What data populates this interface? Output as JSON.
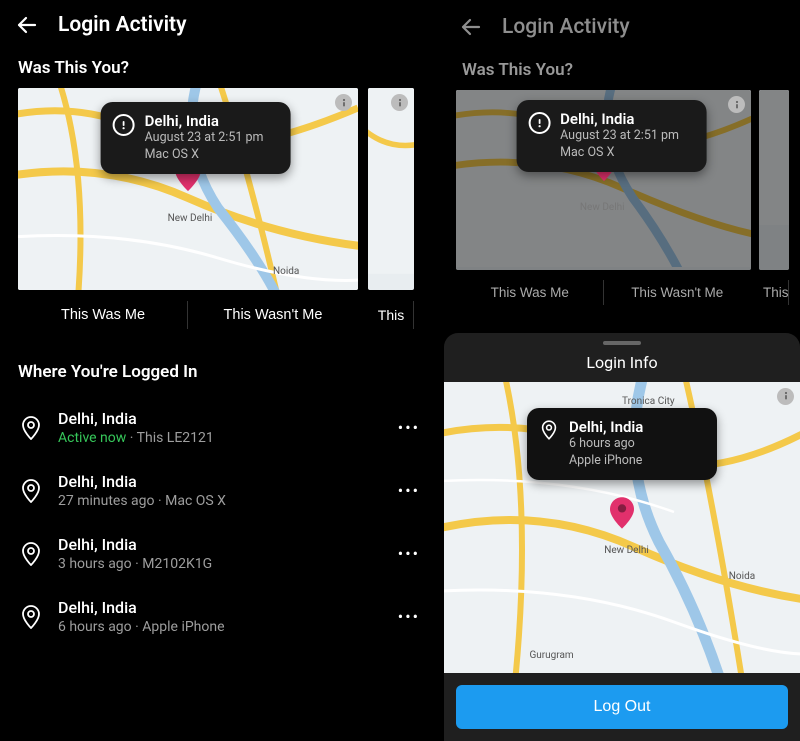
{
  "left": {
    "header_title": "Login Activity",
    "was_this_you": "Was This You?",
    "card": {
      "location": "Delhi, India",
      "time": "August 23 at 2:51 pm",
      "device": "Mac OS X",
      "city_label": "New Delhi",
      "this_was_me": "This Was Me",
      "this_wasnt_me": "This Wasn't Me"
    },
    "peek_btn": "This",
    "where_logged_in": "Where You're Logged In",
    "sessions": [
      {
        "location": "Delhi, India",
        "status_active": "Active now",
        "detail": "This LE2121"
      },
      {
        "location": "Delhi, India",
        "status": "27 minutes ago",
        "detail": "Mac OS X"
      },
      {
        "location": "Delhi, India",
        "status": "3 hours ago",
        "detail": "M2102K1G"
      },
      {
        "location": "Delhi, India",
        "status": "6 hours ago",
        "detail": "Apple iPhone"
      }
    ]
  },
  "right": {
    "header_title": "Login Activity",
    "was_this_you": "Was This You?",
    "card": {
      "location": "Delhi, India",
      "time": "August 23 at 2:51 pm",
      "device": "Mac OS X",
      "city_label": "New Delhi",
      "this_was_me": "This Was Me",
      "this_wasnt_me": "This Wasn't Me"
    },
    "peek_btn": "This",
    "sheet": {
      "title": "Login Info",
      "bubble_location": "Delhi, India",
      "bubble_time": "6 hours ago",
      "bubble_device": "Apple iPhone",
      "city_label": "New Delhi",
      "logout": "Log Out"
    }
  }
}
